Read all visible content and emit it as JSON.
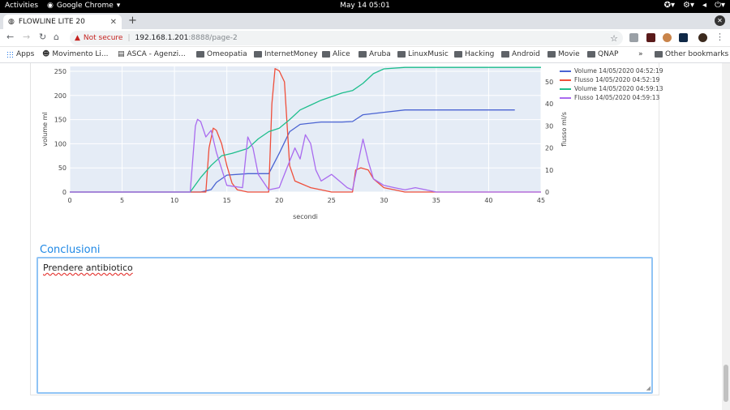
{
  "system": {
    "activities": "Activities",
    "app_name": "Google Chrome",
    "clock": "May 14  05:01"
  },
  "browser": {
    "tab_title": "FLOWLINE LITE 20",
    "not_secure": "Not secure",
    "url_host": "192.168.1.201",
    "url_path": ":8888/page-2",
    "bookmarks": [
      {
        "label": "Apps",
        "icon": "apps-grid-icon"
      },
      {
        "label": "Movimento Li...",
        "icon": "face-icon"
      },
      {
        "label": "ASCA - Agenzi...",
        "icon": "page-icon"
      },
      {
        "label": "Omeopatia",
        "icon": "folder-icon"
      },
      {
        "label": "InternetMoney",
        "icon": "folder-icon"
      },
      {
        "label": "Alice",
        "icon": "folder-icon"
      },
      {
        "label": "Aruba",
        "icon": "folder-icon"
      },
      {
        "label": "LinuxMusic",
        "icon": "folder-icon"
      },
      {
        "label": "Hacking",
        "icon": "folder-icon"
      },
      {
        "label": "Android",
        "icon": "folder-icon"
      },
      {
        "label": "Movie",
        "icon": "folder-icon"
      },
      {
        "label": "QNAP",
        "icon": "folder-icon"
      }
    ],
    "more": "»",
    "other_bookmarks": "Other bookmarks"
  },
  "conclusions": {
    "title": "Conclusioni",
    "text": "Prendere antibiotico"
  },
  "chart_data": {
    "type": "line",
    "xlabel": "secondi",
    "ylabel_left": "volume ml",
    "ylabel_right": "flusso ml/s",
    "xlim": [
      0,
      45
    ],
    "ylim_left": [
      0,
      260
    ],
    "ylim_right": [
      0,
      57
    ],
    "x_ticks": [
      0,
      5,
      10,
      15,
      20,
      25,
      30,
      35,
      40,
      45
    ],
    "y_ticks_left": [
      0,
      50,
      100,
      150,
      200,
      250
    ],
    "y_ticks_right": [
      0,
      10,
      20,
      30,
      40,
      50
    ],
    "grid": true,
    "legend_position": "top-right",
    "series": [
      {
        "name": "Volume 14/05/2020 04:52:19",
        "axis": "left",
        "color": "#4a63d2",
        "x": [
          0,
          12.5,
          13.5,
          14,
          15,
          17,
          19,
          20,
          21,
          22,
          24,
          26,
          27,
          28,
          30,
          32,
          36,
          40,
          42.5
        ],
        "y": [
          0,
          0,
          5,
          20,
          35,
          38,
          38,
          80,
          125,
          140,
          145,
          145,
          146,
          160,
          165,
          170,
          170,
          170,
          170
        ]
      },
      {
        "name": "Flusso 14/05/2020 04:52:19",
        "axis": "right",
        "color": "#ef4f3b",
        "x": [
          0,
          13,
          13.3,
          13.7,
          14,
          14.5,
          15,
          15.5,
          16,
          17,
          19,
          19.3,
          19.6,
          20,
          20.5,
          21,
          21.5,
          22,
          23,
          24,
          25,
          26,
          27,
          27.3,
          27.8,
          28.5,
          29,
          30,
          31,
          32,
          34,
          36,
          45
        ],
        "y": [
          0,
          0,
          20,
          29,
          28,
          22,
          12,
          4,
          1,
          0,
          0,
          40,
          56,
          55,
          50,
          12,
          5,
          4,
          2,
          1,
          0,
          0,
          0,
          10,
          11,
          10,
          6,
          2,
          1,
          0,
          0,
          0,
          0
        ]
      },
      {
        "name": "Volume 14/05/2020 04:59:13",
        "axis": "left",
        "color": "#1dbe8c",
        "x": [
          0,
          11.5,
          12.5,
          13.5,
          14.5,
          15.5,
          17,
          18,
          19,
          20,
          21,
          22,
          24,
          26,
          27,
          28,
          29,
          30,
          32,
          36,
          40,
          45
        ],
        "y": [
          0,
          0,
          30,
          55,
          75,
          80,
          90,
          110,
          125,
          132,
          150,
          170,
          190,
          205,
          210,
          225,
          245,
          255,
          258,
          258,
          258,
          258
        ]
      },
      {
        "name": "Flusso 14/05/2020 04:59:13",
        "axis": "right",
        "color": "#a96bef",
        "x": [
          0,
          11.5,
          12,
          12.2,
          12.5,
          13,
          13.5,
          14,
          15,
          16.5,
          17,
          17.5,
          18,
          19,
          20,
          21,
          21.5,
          22,
          22.5,
          23,
          23.5,
          24,
          25,
          26,
          26.5,
          27,
          28,
          28.5,
          29,
          30,
          31,
          32,
          33,
          34,
          35,
          45
        ],
        "y": [
          0,
          0,
          30,
          33,
          32,
          25,
          28,
          18,
          3,
          2,
          25,
          20,
          8,
          1,
          2,
          14,
          20,
          15,
          26,
          22,
          10,
          5,
          8,
          4,
          2,
          1,
          24,
          14,
          6,
          3,
          2,
          1,
          2,
          1,
          0,
          0
        ]
      }
    ]
  }
}
